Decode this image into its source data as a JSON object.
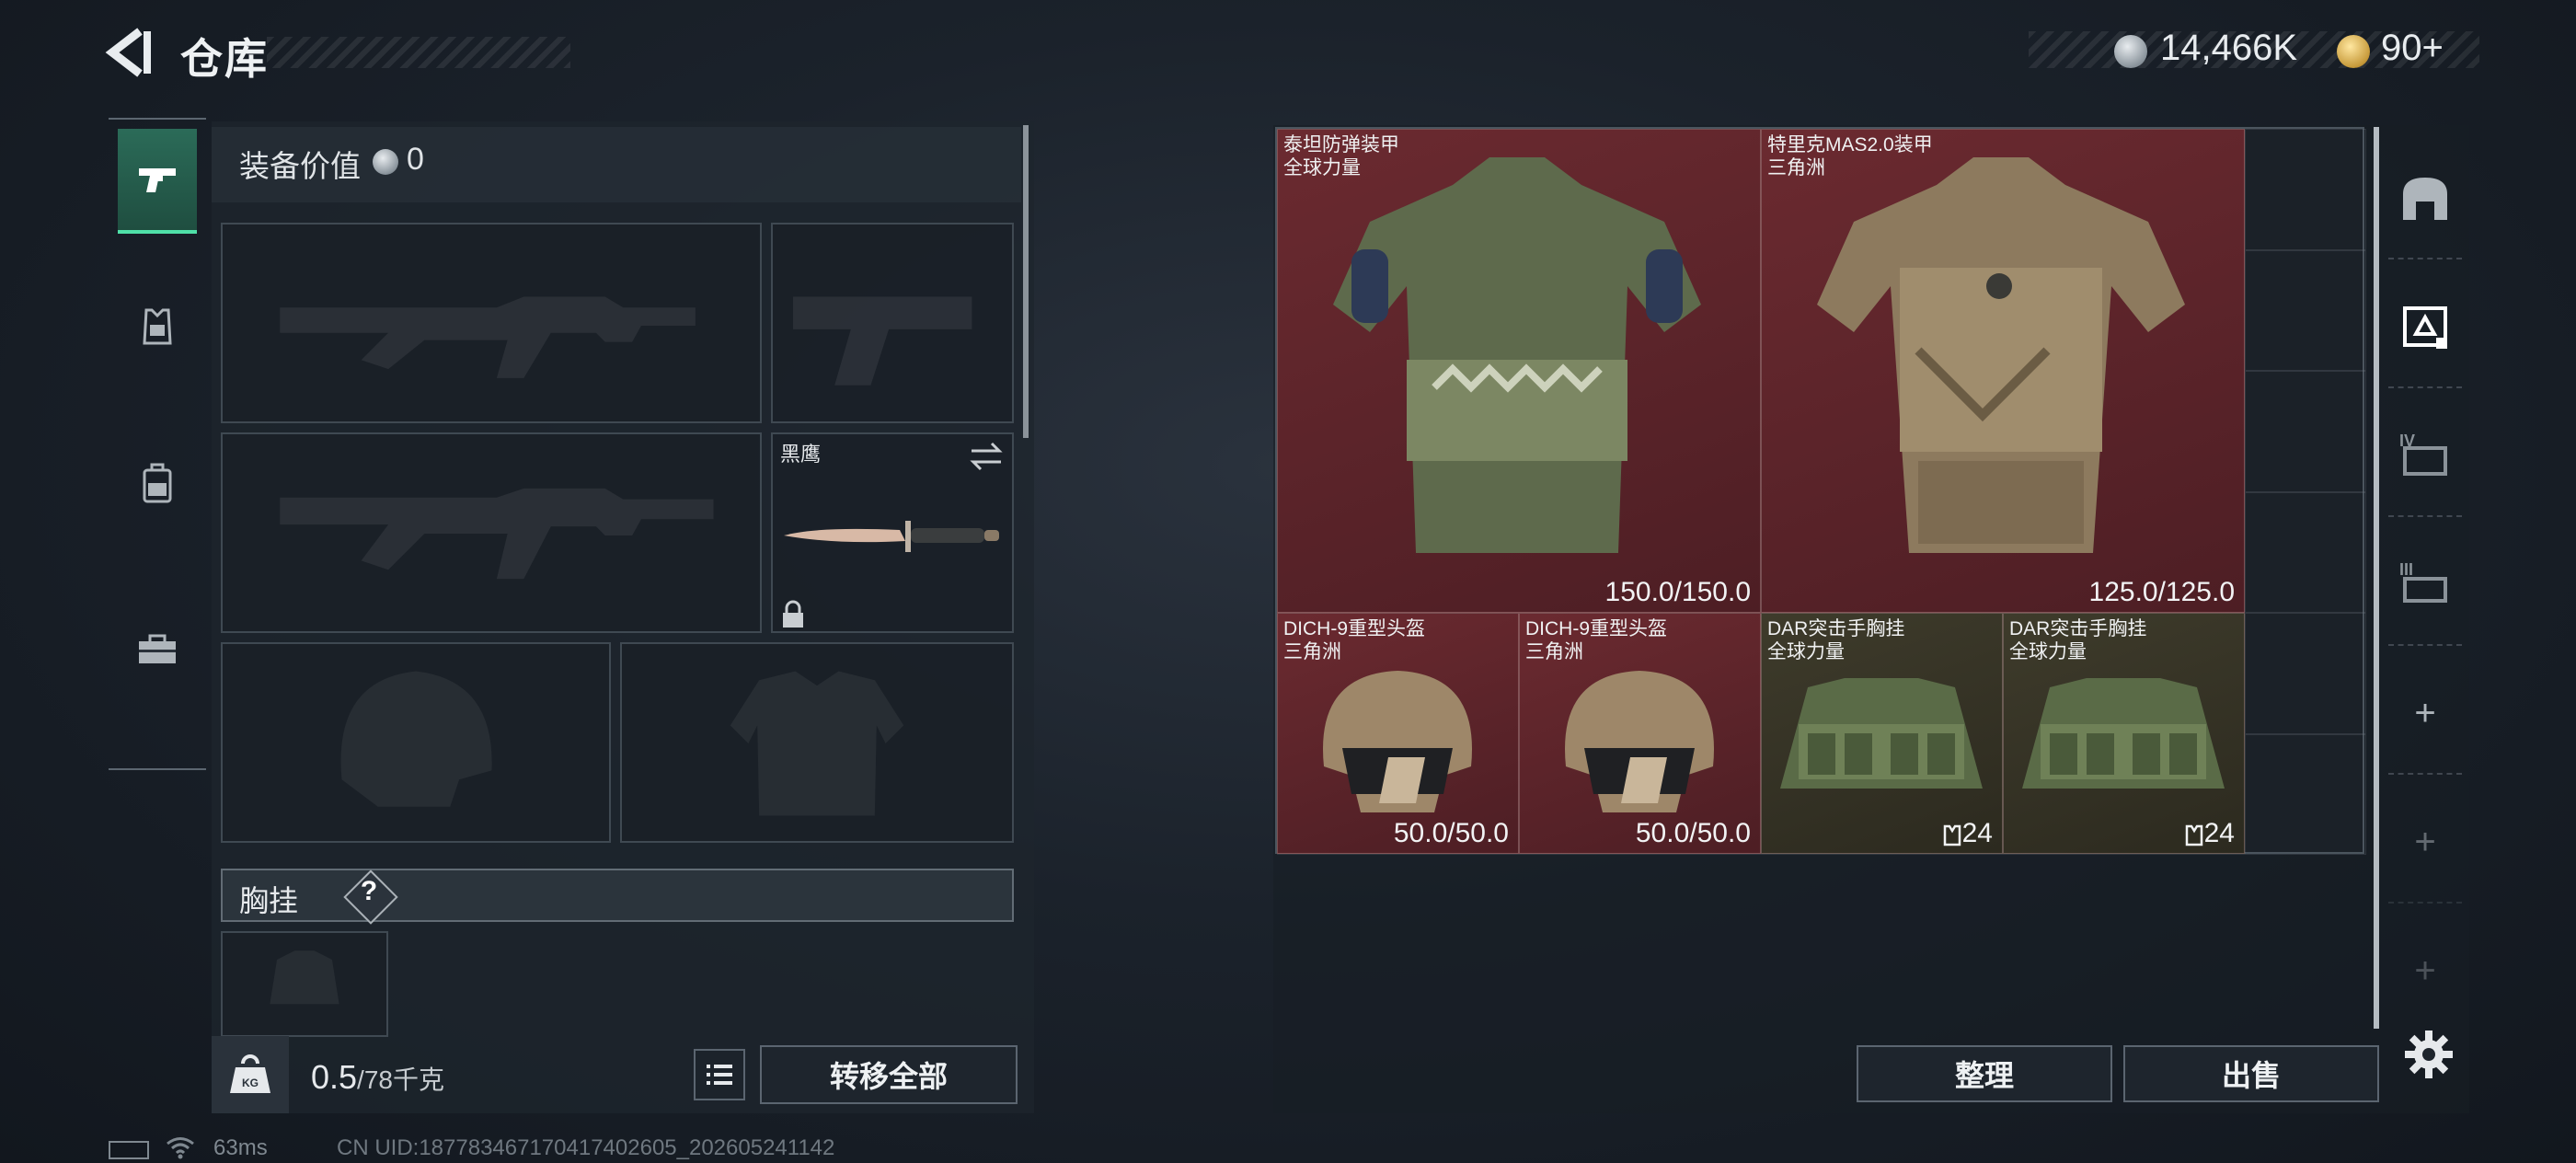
{
  "header": {
    "title": "仓库"
  },
  "currency": [
    {
      "icon": "silver-coin-icon",
      "value": "14,466K"
    },
    {
      "icon": "gold-coin-icon",
      "value": "90+"
    }
  ],
  "left_nav": [
    {
      "name": "weapons",
      "icon": "pistol-icon",
      "active": true
    },
    {
      "name": "armor",
      "icon": "armor-icon",
      "active": false
    },
    {
      "name": "backpack",
      "icon": "backpack-icon",
      "active": false
    },
    {
      "name": "toolbox",
      "icon": "toolbox-icon",
      "active": false
    }
  ],
  "loadout": {
    "value_label": "装备价值",
    "value_amount": "0",
    "knife_name": "黑鹰",
    "chest_rig_label": "胸挂",
    "help_symbol": "?",
    "weight_current": "0.5",
    "weight_max": "/78千克",
    "transfer_all_label": "转移全部"
  },
  "stash": {
    "items": [
      {
        "name": "泰坦防弹装甲",
        "faction": "全球力量",
        "stat": "150.0/150.0",
        "kind": "armor-green"
      },
      {
        "name": "特里克MAS2.0装甲",
        "faction": "三角洲",
        "stat": "125.0/125.0",
        "kind": "armor-tan"
      },
      {
        "name": "DICH-9重型头盔",
        "faction": "三角洲",
        "stat": "50.0/50.0",
        "kind": "helmet"
      },
      {
        "name": "DICH-9重型头盔",
        "faction": "三角洲",
        "stat": "50.0/50.0",
        "kind": "helmet"
      },
      {
        "name": "DAR突击手胸挂",
        "faction": "全球力量",
        "stat": "24",
        "kind": "rig"
      },
      {
        "name": "DAR突击手胸挂",
        "faction": "全球力量",
        "stat": "24",
        "kind": "rig"
      }
    ],
    "sort_label": "整理",
    "sell_label": "出售"
  },
  "status": {
    "latency": "63ms",
    "uid": "CN UID:187783467170417402605_202605241142"
  },
  "colors": {
    "accent": "#4fe0a8",
    "item_red": "#5a2328",
    "item_gold": "#35321f"
  }
}
